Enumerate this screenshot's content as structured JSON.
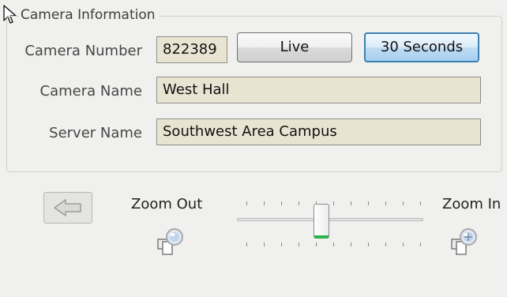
{
  "camera_info": {
    "group_title": "Camera Information",
    "camera_number_label": "Camera Number",
    "camera_number_value": "822389",
    "live_button_label": "Live",
    "seconds_button_label": "30 Seconds",
    "camera_name_label": "Camera Name",
    "camera_name_value": "West Hall",
    "server_name_label": "Server Name",
    "server_name_value": "Southwest Area Campus"
  },
  "controls": {
    "back_icon": "arrow-left-icon",
    "zoom_out_label": "Zoom Out",
    "zoom_out_icon": "magnifier-minus-icon",
    "zoom_in_label": "Zoom In",
    "zoom_in_icon": "magnifier-plus-icon",
    "zoom_level_fraction": 0.45,
    "accent_color": "#2fb14a"
  }
}
